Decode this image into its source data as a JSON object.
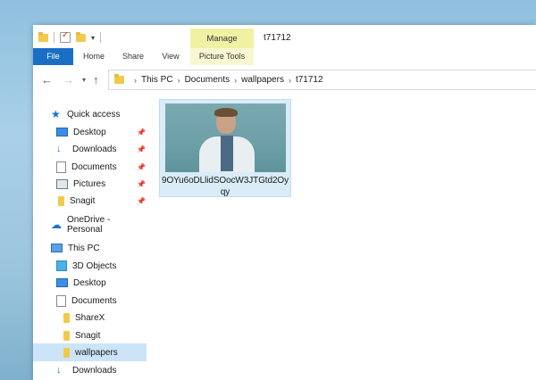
{
  "window": {
    "title": "t71712",
    "manage_label": "Manage"
  },
  "ribbon": {
    "tabs": [
      {
        "label": "File"
      },
      {
        "label": "Home"
      },
      {
        "label": "Share"
      },
      {
        "label": "View"
      },
      {
        "label": "Picture Tools"
      }
    ]
  },
  "address": {
    "crumbs": [
      "This PC",
      "Documents",
      "wallpapers",
      "t71712"
    ]
  },
  "nav": {
    "items": [
      {
        "label": "Quick access",
        "icon": "star-icon"
      },
      {
        "label": "Desktop",
        "icon": "desktop-icon",
        "pinned": true
      },
      {
        "label": "Downloads",
        "icon": "download-icon",
        "pinned": true
      },
      {
        "label": "Documents",
        "icon": "documents-icon",
        "pinned": true
      },
      {
        "label": "Pictures",
        "icon": "pictures-icon",
        "pinned": true
      },
      {
        "label": "Snagit",
        "icon": "folder-icon",
        "pinned": true
      },
      {
        "label": "OneDrive - Personal",
        "icon": "cloud-icon"
      },
      {
        "label": "This PC",
        "icon": "computer-icon"
      },
      {
        "label": "3D Objects",
        "icon": "3d-objects-icon"
      },
      {
        "label": "Desktop",
        "icon": "desktop-icon"
      },
      {
        "label": "Documents",
        "icon": "documents-icon"
      },
      {
        "label": "ShareX",
        "icon": "folder-icon"
      },
      {
        "label": "Snagit",
        "icon": "folder-icon"
      },
      {
        "label": "wallpapers",
        "icon": "folder-icon",
        "selected": true
      },
      {
        "label": "Downloads",
        "icon": "download-icon"
      }
    ]
  },
  "files": [
    {
      "name": "9OYu6oDLlidSOocW3JTGtd2Oyqy"
    }
  ],
  "colors": {
    "file_tab": "#1a6fc4",
    "manage_tab": "#f0f1a3",
    "selected_nav": "#cce4f7",
    "selected_tile": "#d9ecf8"
  }
}
